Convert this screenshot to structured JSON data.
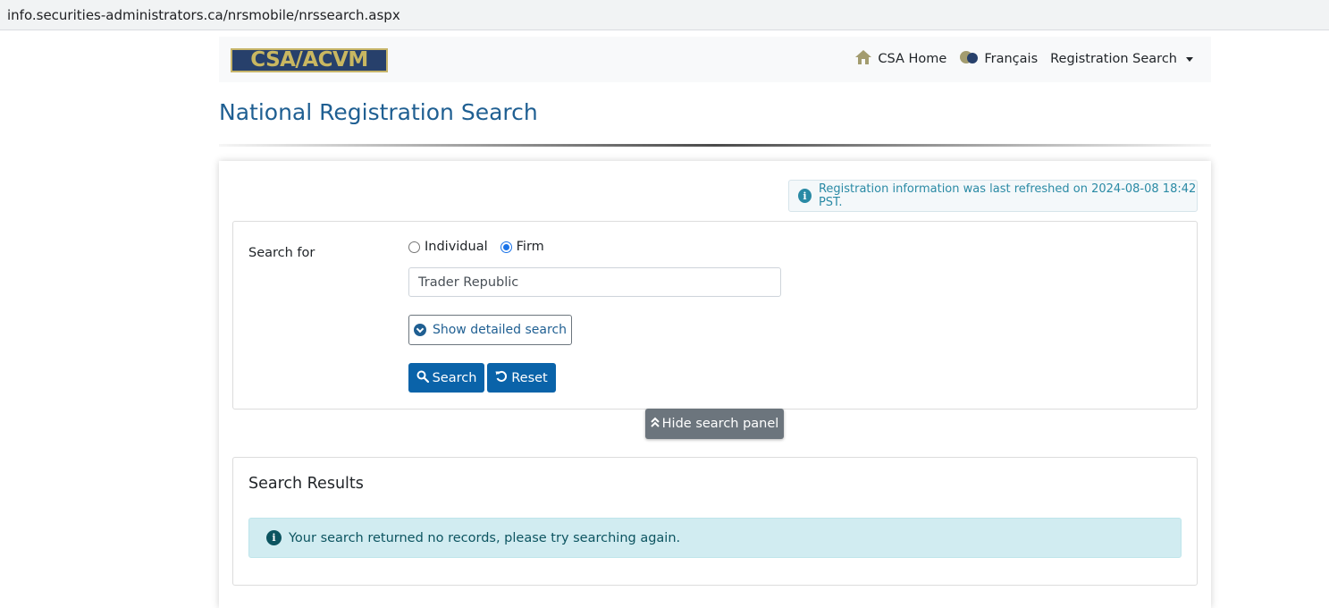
{
  "browser": {
    "url": "info.securities-administrators.ca/nrsmobile/nrssearch.aspx"
  },
  "nav": {
    "logo_text": "CSA/ACVM",
    "home_label": "CSA Home",
    "lang_label": "Français",
    "registration_menu_label": "Registration Search"
  },
  "page": {
    "title": "National Registration Search"
  },
  "refresh_notice": "Registration information was last refreshed on 2024-08-08 18:42 PST.",
  "search": {
    "search_for_label": "Search for",
    "options": {
      "individual": "Individual",
      "firm": "Firm"
    },
    "selected": "Firm",
    "query_value": "Trader Republic",
    "detailed_search_label": "Show detailed search",
    "search_button": "Search",
    "reset_button": "Reset",
    "hide_panel_button": "Hide search panel"
  },
  "results": {
    "title": "Search Results",
    "message": "Your search returned no records, please try searching again."
  },
  "colors": {
    "title_blue": "#1f5f92",
    "button_blue": "#0a63a9",
    "info_bg": "#d1ecf1"
  }
}
